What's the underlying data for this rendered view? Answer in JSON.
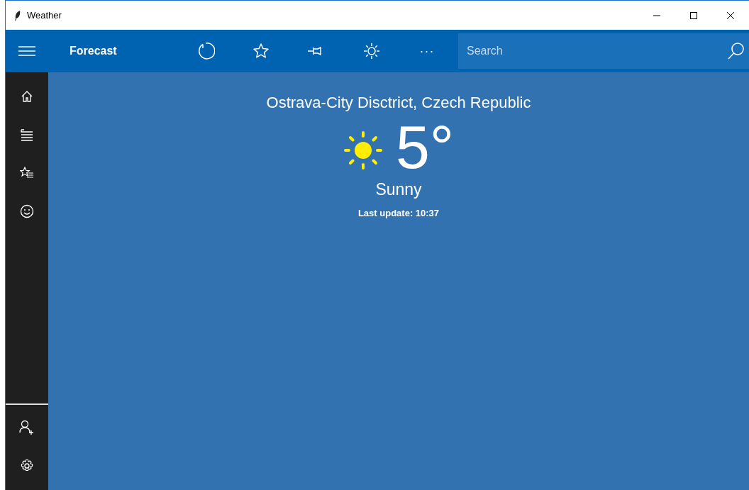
{
  "window": {
    "title": "Weather"
  },
  "app_bar": {
    "title": "Forecast",
    "search": {
      "placeholder": "Search"
    },
    "more": "···"
  },
  "location": "Ostrava-City Disctrict, Czech Republic",
  "temperature": "5°",
  "condition": "Sunny",
  "last_update": "Last update: 10:37"
}
